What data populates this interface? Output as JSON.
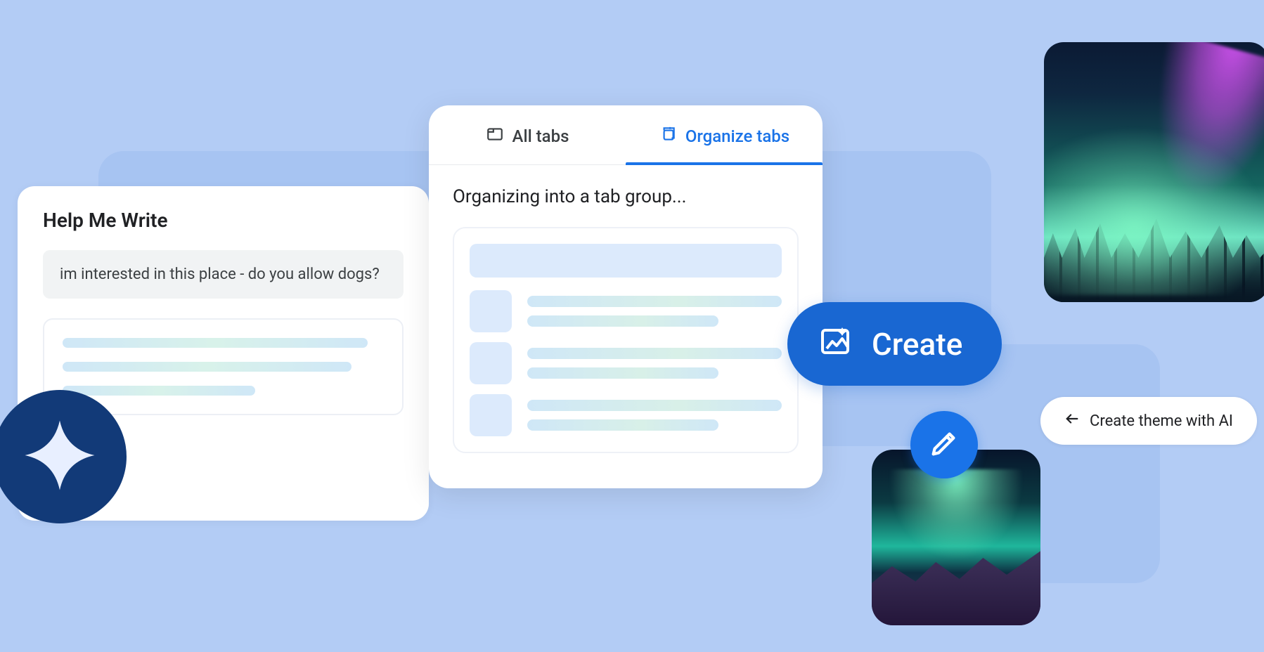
{
  "helpMeWrite": {
    "title": "Help Me Write",
    "input_text": "im interested in this place - do you allow dogs?"
  },
  "tabsPanel": {
    "tabs": [
      {
        "label": "All tabs",
        "active": false
      },
      {
        "label": "Organize tabs",
        "active": true
      }
    ],
    "body_title": "Organizing into a tab group..."
  },
  "createButton": {
    "label": "Create"
  },
  "themePill": {
    "label": "Create theme with AI"
  },
  "icons": {
    "sparkle": "sparkle-icon",
    "tab": "tab-icon",
    "organize": "organize-tabs-icon",
    "image_sparkle": "image-sparkle-icon",
    "arrow_left": "arrow-left-icon",
    "pencil": "pencil-icon"
  },
  "colors": {
    "page_bg": "#b3ccf5",
    "card_bg": "#ffffff",
    "primary": "#1a73e8",
    "primary_dark": "#1967d2",
    "sparkle_badge": "#123a78",
    "skeleton": "#dceafc"
  }
}
